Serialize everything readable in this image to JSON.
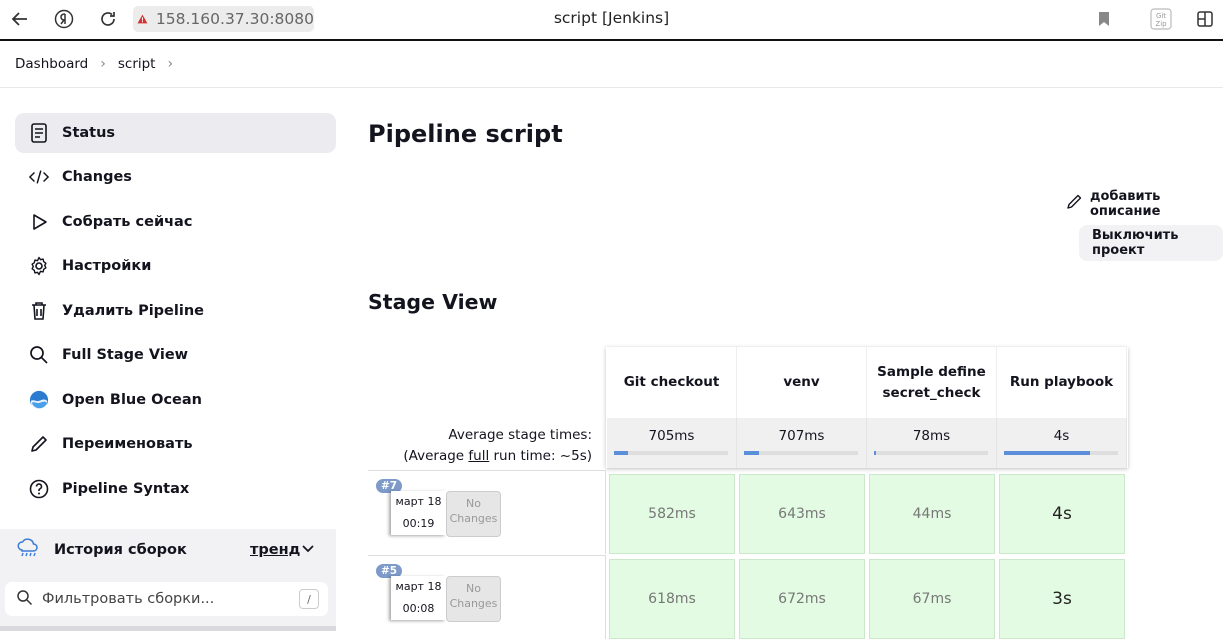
{
  "browser": {
    "url": "158.160.37.30:8080",
    "window_title": "script [Jenkins]"
  },
  "breadcrumb": {
    "items": [
      "Dashboard",
      "script"
    ]
  },
  "sidebar": {
    "items": [
      {
        "label": "Status",
        "icon": "document-icon"
      },
      {
        "label": "Changes",
        "icon": "code-icon"
      },
      {
        "label": "Собрать сейчас",
        "icon": "play-icon"
      },
      {
        "label": "Настройки",
        "icon": "gear-icon"
      },
      {
        "label": "Удалить Pipeline",
        "icon": "trash-icon"
      },
      {
        "label": "Full Stage View",
        "icon": "search-icon"
      },
      {
        "label": "Open Blue Ocean",
        "icon": "blue-ocean-icon"
      },
      {
        "label": "Переименовать",
        "icon": "pencil-icon"
      },
      {
        "label": "Pipeline Syntax",
        "icon": "help-icon"
      }
    ],
    "history": {
      "title": "История сборок",
      "trend": "тренд"
    },
    "filter": {
      "placeholder": "Фильтровать сборки...",
      "shortcut": "/"
    }
  },
  "main": {
    "title": "Pipeline script",
    "add_description": "добавить описание",
    "disable_project": "Выключить проект",
    "stage_view_title": "Stage View"
  },
  "stage_view": {
    "avg_label_line1": "Average stage times:",
    "avg_label_prefix": "(Average ",
    "avg_label_full": "full",
    "avg_label_suffix": " run time: ~5s)",
    "stages": [
      {
        "name_line1": "Git checkout",
        "name_line2": "",
        "avg": "705ms",
        "avg_fraction": 0.12
      },
      {
        "name_line1": "venv",
        "name_line2": "",
        "avg": "707ms",
        "avg_fraction": 0.13
      },
      {
        "name_line1": "Sample define",
        "name_line2": "secret_check",
        "avg": "78ms",
        "avg_fraction": 0.02
      },
      {
        "name_line1": "Run playbook",
        "name_line2": "",
        "avg": "4s",
        "avg_fraction": 0.75
      }
    ],
    "builds": [
      {
        "number": "#7",
        "date": "март 18",
        "time": "00:19",
        "changes": "No Changes",
        "times": [
          "582ms",
          "643ms",
          "44ms",
          "4s"
        ]
      },
      {
        "number": "#5",
        "date": "март 18",
        "time": "00:08",
        "changes": "No Changes",
        "times": [
          "618ms",
          "672ms",
          "67ms",
          "3s"
        ]
      }
    ]
  },
  "colors": {
    "success_cell": "#e3fbe2",
    "badge": "#7d9ac9",
    "progress": "#5b8fd9",
    "sidebar_active": "#ececf0"
  }
}
